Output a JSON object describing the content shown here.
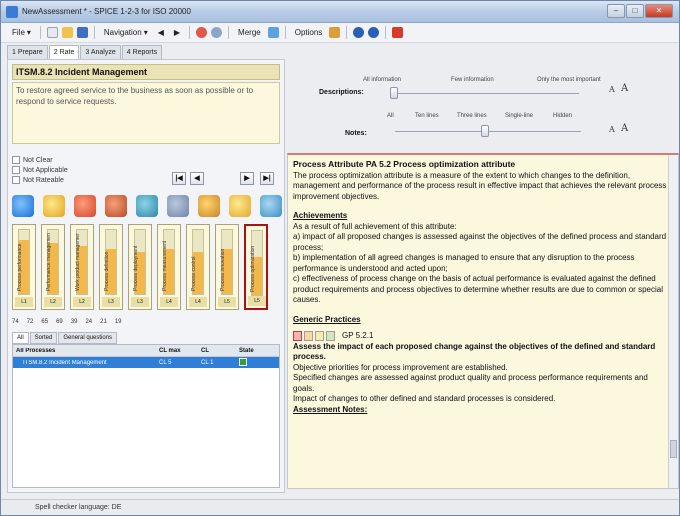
{
  "window": {
    "title": "NewAssessment * - SPICE 1-2-3 for ISO 20000"
  },
  "menu": {
    "file": "File",
    "navigation": "Navigation",
    "merge": "Merge",
    "options": "Options"
  },
  "tabs": [
    "1 Prepare",
    "2 Rate",
    "3 Analyze",
    "4 Reports"
  ],
  "process": {
    "name": "ITSM.8.2 Incident Management",
    "description": "To restore agreed service to the business as soon as possible or to respond to service requests."
  },
  "checks": [
    "Not Clear",
    "Not Applicable",
    "Not Rateable"
  ],
  "nav": [
    "|◀",
    "◀",
    "▶",
    "▶|"
  ],
  "bars": [
    {
      "label": "Process performance",
      "level": 0.85,
      "foot": "L1"
    },
    {
      "label": "Performance management",
      "level": 0.8,
      "foot": "L2"
    },
    {
      "label": "Work product management",
      "level": 0.75,
      "foot": "L2"
    },
    {
      "label": "Process definition",
      "level": 0.7,
      "foot": "L3"
    },
    {
      "label": "Process deployment",
      "level": 0.65,
      "foot": "L3"
    },
    {
      "label": "Process measurement",
      "level": 0.7,
      "foot": "L4"
    },
    {
      "label": "Process control",
      "level": 0.65,
      "foot": "L4"
    },
    {
      "label": "Process innovation",
      "level": 0.7,
      "foot": "L5"
    },
    {
      "label": "Process optimization",
      "level": 0.6,
      "foot": "L5"
    }
  ],
  "ratings": [
    "74",
    "72",
    "65",
    "69",
    "39",
    "24",
    "21",
    "19"
  ],
  "subtabs": [
    "All",
    "Sorted",
    "General questions"
  ],
  "table": {
    "headers": [
      "All Processes",
      "CL max",
      "CL",
      "State"
    ],
    "row": {
      "process": "ITSM.8.2 Incident Management",
      "clmax": "CL 5",
      "cl": "CL 1"
    }
  },
  "descriptions": {
    "label": "Descriptions:",
    "options": [
      "All information",
      "Few information",
      "Only the most important"
    ]
  },
  "notes": {
    "label": "Notes:",
    "options": [
      "All",
      "Ten lines",
      "Three lines",
      "Single-line",
      "Hidden"
    ]
  },
  "doc": {
    "title": "Process Attribute  PA 5.2  Process optimization attribute",
    "intro": "The process optimization attribute is a measure of the extent to which changes to the definition, management and performance of the process result in effective impact that achieves the relevant process improvement objectives.",
    "achievements_head": "Achievements",
    "achievements": [
      "As a result of full achievement of this attribute:",
      "a) impact of all proposed changes is assessed against the objectives of the defined process and standard process;",
      "b) implementation of all agreed changes is managed to ensure that any disruption to the process performance is understood and acted upon;",
      "c) effectiveness of process change on the basis of actual performance is evaluated against the defined product requirements and process objectives to determine whether results are due to common or special causes."
    ],
    "generic_head": "Generic Practices",
    "gp_id": "GP 5.2.1",
    "gp_title": "Assess the impact of each proposed change against the objectives of the defined and standard process.",
    "gp_lines": [
      "Objective priorities for process improvement are established.",
      "Specified changes are assessed against product quality and process performance requirements and goals.",
      "Impact of changes to other defined and standard processes is considered."
    ],
    "notes_head": "Assessment Notes:"
  },
  "status": {
    "text": "Spell checker language:  DE"
  }
}
